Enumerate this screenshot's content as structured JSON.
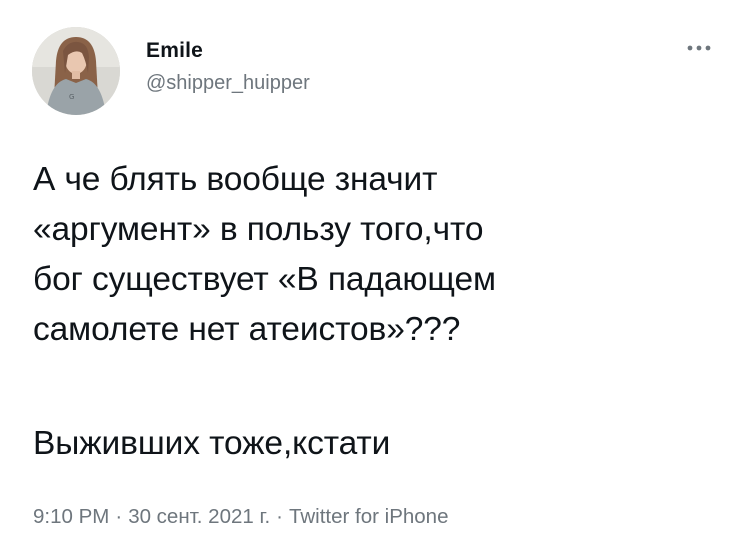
{
  "author": {
    "display_name": "Emile",
    "handle": "@shipper_huipper",
    "avatar_icon": "user-photo-avatar"
  },
  "more_icon": "more-horizontal-icon",
  "tweet": {
    "lines": [
      "А че блять вообще значит",
      "«аргумент» в пользу того,что",
      "бог существует «В падающем",
      "самолете нет атеистов»???"
    ],
    "last_line": "Выживших тоже,кстати"
  },
  "meta": {
    "time": "9:10 PM",
    "date": "30 сент. 2021 г.",
    "source": "Twitter for iPhone",
    "separator": "·"
  },
  "colors": {
    "text": "#0f1419",
    "secondary": "#6e767d",
    "background": "#ffffff"
  }
}
